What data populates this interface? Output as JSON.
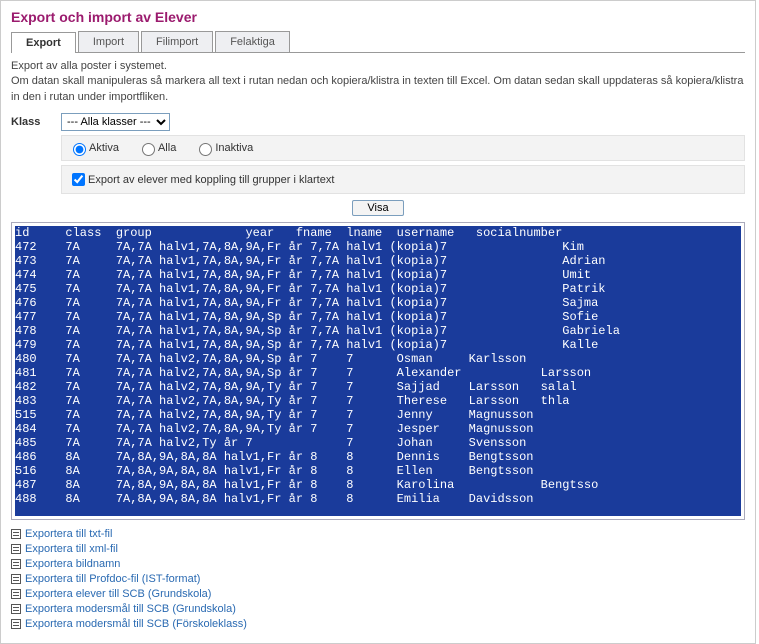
{
  "title": "Export och import av Elever",
  "tabs": [
    "Export",
    "Import",
    "Filimport",
    "Felaktiga"
  ],
  "active_tab": 0,
  "info_line1": "Export av alla poster i systemet.",
  "info_line2": "Om datan skall manipuleras så markera all text i rutan nedan och kopiera/klistra in texten till Excel. Om datan sedan skall uppdateras så kopiera/klistra in den i rutan under importfliken.",
  "klass_label": "Klass",
  "klass_selected": "--- Alla klasser ---",
  "radio": {
    "aktiva": "Aktiva",
    "alla": "Alla",
    "inaktiva": "Inaktiva"
  },
  "checkbox_label": "Export av elever med koppling till grupper i klartext",
  "visa_label": "Visa",
  "table": {
    "headers": [
      "id",
      "class",
      "group",
      "year",
      "fname",
      "lname",
      "username",
      "socialnumber"
    ],
    "rows": [
      [
        "472",
        "7A",
        "7A,7A halv1,7A,8A,9A,Fr år 7,7A halv1 (kopia)",
        "7",
        "",
        "Kim"
      ],
      [
        "473",
        "7A",
        "7A,7A halv1,7A,8A,9A,Fr år 7,7A halv1 (kopia)",
        "7",
        "",
        "Adrian"
      ],
      [
        "474",
        "7A",
        "7A,7A halv1,7A,8A,9A,Fr år 7,7A halv1 (kopia)",
        "7",
        "",
        "Umit"
      ],
      [
        "475",
        "7A",
        "7A,7A halv1,7A,8A,9A,Fr år 7,7A halv1 (kopia)",
        "7",
        "",
        "Patrik"
      ],
      [
        "476",
        "7A",
        "7A,7A halv1,7A,8A,9A,Fr år 7,7A halv1 (kopia)",
        "7",
        "",
        "Sajma"
      ],
      [
        "477",
        "7A",
        "7A,7A halv1,7A,8A,9A,Sp år 7,7A halv1 (kopia)",
        "7",
        "",
        "Sofie"
      ],
      [
        "478",
        "7A",
        "7A,7A halv1,7A,8A,9A,Sp år 7,7A halv1 (kopia)",
        "7",
        "",
        "Gabriela"
      ],
      [
        "479",
        "7A",
        "7A,7A halv1,7A,8A,9A,Sp år 7,7A halv1 (kopia)",
        "7",
        "",
        "Kalle"
      ],
      [
        "480",
        "7A",
        "7A,7A halv2,7A,8A,9A,Sp år 7",
        "7",
        "Osman",
        "Karlsson"
      ],
      [
        "481",
        "7A",
        "7A,7A halv2,7A,8A,9A,Sp år 7",
        "7",
        "Alexander",
        "",
        "Larsson"
      ],
      [
        "482",
        "7A",
        "7A,7A halv2,7A,8A,9A,Ty år 7",
        "7",
        "Sajjad",
        "Larsson",
        "salal"
      ],
      [
        "483",
        "7A",
        "7A,7A halv2,7A,8A,9A,Ty år 7",
        "7",
        "Therese",
        "Larsson",
        "thla"
      ],
      [
        "515",
        "7A",
        "7A,7A halv2,7A,8A,9A,Ty år 7",
        "7",
        "Jenny",
        "Magnusson"
      ],
      [
        "484",
        "7A",
        "7A,7A halv2,7A,8A,9A,Ty år 7",
        "7",
        "Jesper",
        "Magnusson"
      ],
      [
        "485",
        "7A",
        "7A,7A halv2,Ty år 7",
        "7",
        "Johan",
        "Svensson"
      ],
      [
        "486",
        "8A",
        "7A,8A,9A,8A,8A halv1,Fr år 8",
        "8",
        "Dennis",
        "Bengtsson"
      ],
      [
        "516",
        "8A",
        "7A,8A,9A,8A,8A halv1,Fr år 8",
        "8",
        "Ellen",
        "Bengtsson"
      ],
      [
        "487",
        "8A",
        "7A,8A,9A,8A,8A halv1,Fr år 8",
        "8",
        "Karolina",
        "",
        "Bengtsso"
      ],
      [
        "488",
        "8A",
        "7A,8A,9A,8A,8A halv1,Fr år 8",
        "8",
        "Emilia",
        "Davidsson"
      ]
    ]
  },
  "export_links": [
    "Exportera till txt-fil",
    "Exportera till xml-fil",
    "Exportera bildnamn",
    "Exportera till Profdoc-fil (IST-format)",
    "Exportera elever till SCB (Grundskola)",
    "Exportera modersmål till SCB (Grundskola)",
    "Exportera modersmål till SCB (Förskoleklass)"
  ],
  "chart_data": null
}
